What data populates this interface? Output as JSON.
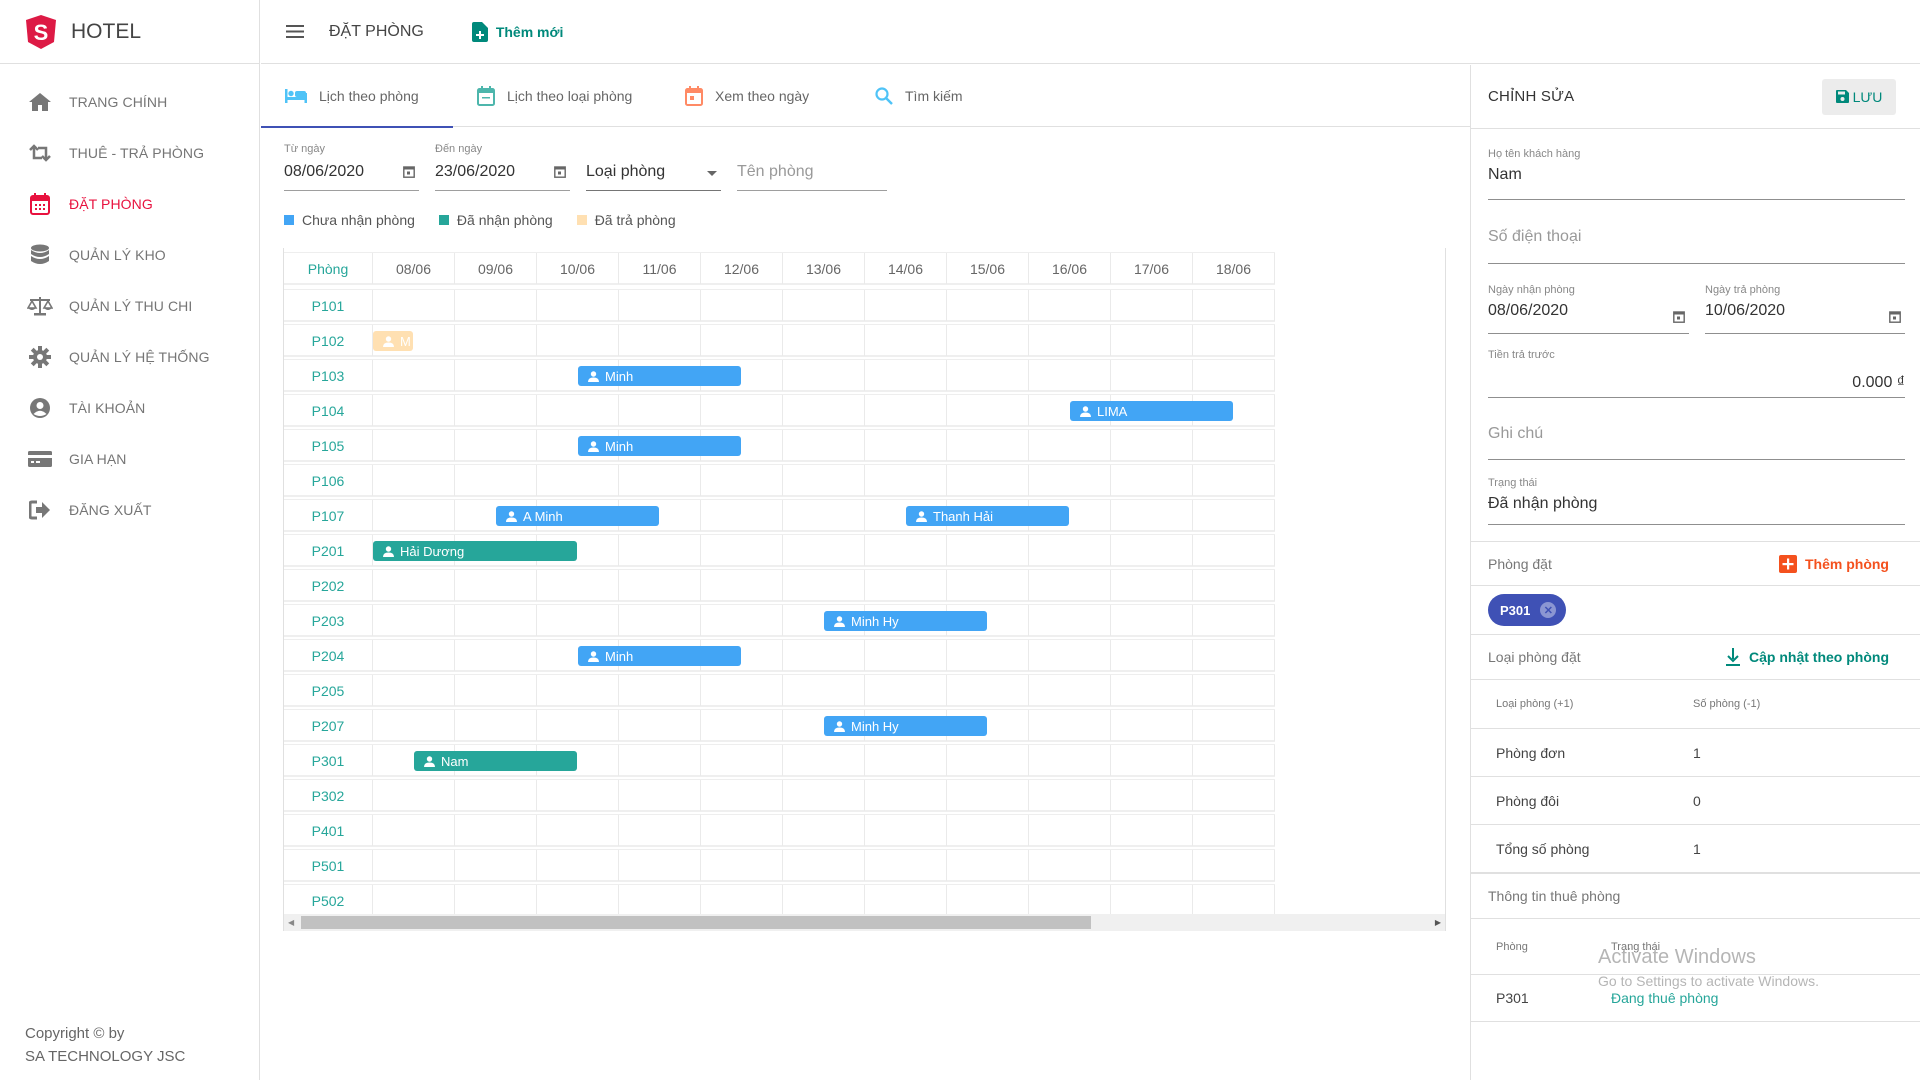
{
  "brand": {
    "name": "HOTEL"
  },
  "sidebar": {
    "items": [
      {
        "label": "TRANG CHÍNH",
        "icon": "home-icon",
        "active": false
      },
      {
        "label": "THUÊ - TRẢ PHÒNG",
        "icon": "swap-icon",
        "active": false
      },
      {
        "label": "ĐẶT PHÒNG",
        "icon": "calendar-icon",
        "active": true
      },
      {
        "label": "QUẢN LÝ KHO",
        "icon": "database-icon",
        "active": false
      },
      {
        "label": "QUẢN LÝ THU CHI",
        "icon": "balance-scale-icon",
        "active": false
      },
      {
        "label": "QUẢN LÝ HỆ THỐNG",
        "icon": "gear-icon",
        "active": false
      },
      {
        "label": "TÀI KHOẢN",
        "icon": "account-circle-icon",
        "active": false
      },
      {
        "label": "GIA HẠN",
        "icon": "credit-card-icon",
        "active": false
      },
      {
        "label": "ĐĂNG XUẤT",
        "icon": "logout-icon",
        "active": false
      }
    ],
    "copyright_line1": "Copyright © by",
    "copyright_line2": "SA TECHNOLOGY JSC"
  },
  "topbar": {
    "title": "ĐẶT PHÒNG",
    "add_new": "Thêm mới"
  },
  "tabs": [
    {
      "label": "Lịch theo phòng",
      "icon": "bed-icon",
      "active": true
    },
    {
      "label": "Lịch theo loại phòng",
      "icon": "calendar-icon",
      "active": false
    },
    {
      "label": "Xem theo ngày",
      "icon": "calendar-day-icon",
      "active": false
    },
    {
      "label": "Tìm kiếm",
      "icon": "search-icon",
      "active": false
    }
  ],
  "filters": {
    "from_label": "Từ ngày",
    "from_value": "08/06/2020",
    "to_label": "Đến ngày",
    "to_value": "23/06/2020",
    "room_type_value": "Loại phòng",
    "room_name_placeholder": "Tên phòng"
  },
  "legend": [
    {
      "label": "Chưa nhận phòng",
      "color": "#42a5f5"
    },
    {
      "label": "Đã nhận phòng",
      "color": "#26a69a"
    },
    {
      "label": "Đã trả phòng",
      "color": "#ffe0b2"
    }
  ],
  "schedule": {
    "room_header": "Phòng",
    "dates": [
      "08/06",
      "09/06",
      "10/06",
      "11/06",
      "12/06",
      "13/06",
      "14/06",
      "15/06",
      "16/06",
      "17/06",
      "18/06"
    ],
    "rooms": [
      "P101",
      "P102",
      "P103",
      "P104",
      "P105",
      "P106",
      "P107",
      "P201",
      "P202",
      "P203",
      "P204",
      "P205",
      "P207",
      "P301",
      "P302",
      "P401",
      "P501",
      "P502"
    ],
    "bookings": [
      {
        "room": "P102",
        "guest": "M",
        "start": 0,
        "end": 0.5,
        "status": "checked_out"
      },
      {
        "room": "P103",
        "guest": "Minh",
        "start": 2.5,
        "end": 4.5,
        "status": "not_checked_in"
      },
      {
        "room": "P104",
        "guest": "LIMA",
        "start": 8.5,
        "end": 10.5,
        "status": "not_checked_in"
      },
      {
        "room": "P105",
        "guest": "Minh",
        "start": 2.5,
        "end": 4.5,
        "status": "not_checked_in"
      },
      {
        "room": "P107",
        "guest": "A Minh",
        "start": 1.5,
        "end": 3.5,
        "status": "not_checked_in"
      },
      {
        "room": "P107",
        "guest": "Thanh Hải",
        "start": 6.5,
        "end": 8.5,
        "status": "not_checked_in"
      },
      {
        "room": "P201",
        "guest": "Hải Dương",
        "start": 0,
        "end": 2.5,
        "status": "checked_in"
      },
      {
        "room": "P203",
        "guest": "Minh Hy",
        "start": 5.5,
        "end": 7.5,
        "status": "not_checked_in"
      },
      {
        "room": "P204",
        "guest": "Minh",
        "start": 2.5,
        "end": 4.5,
        "status": "not_checked_in"
      },
      {
        "room": "P207",
        "guest": "Minh Hy",
        "start": 5.5,
        "end": 7.5,
        "status": "not_checked_in"
      },
      {
        "room": "P301",
        "guest": "Nam",
        "start": 0.5,
        "end": 2.5,
        "status": "checked_in"
      }
    ],
    "status_colors": {
      "not_checked_in": "#42a5f5",
      "checked_in": "#26a69a",
      "checked_out": "#ffe0b2"
    },
    "scroll_fraction": 0.7
  },
  "panel": {
    "title": "CHỈNH SỬA",
    "save": "LƯU",
    "name_label": "Họ tên khách hàng",
    "name_value": "Nam",
    "phone_placeholder": "Số điện thoại",
    "checkin_label": "Ngày nhận phòng",
    "checkin_value": "08/06/2020",
    "checkout_label": "Ngày trả phòng",
    "checkout_value": "10/06/2020",
    "deposit_label": "Tiền trả trước",
    "deposit_value": "0.000 ₫",
    "note_placeholder": "Ghi chú",
    "status_label": "Trạng thái",
    "status_value": "Đã nhận phòng",
    "booked_rooms_label": "Phòng đặt",
    "add_room": "Thêm phòng",
    "chips": [
      "P301"
    ],
    "room_types_label": "Loại phòng đặt",
    "update_by_room": "Cập nhật theo phòng",
    "type_table": {
      "headers": [
        "Loại phòng (+1)",
        "Số phòng (-1)"
      ],
      "rows": [
        [
          "Phòng đơn",
          "1"
        ],
        [
          "Phòng đôi",
          "0"
        ],
        [
          "Tổng số phòng",
          "1"
        ]
      ]
    },
    "rental_info_label": "Thông tin thuê phòng",
    "rental_table": {
      "headers": [
        "Phòng",
        "Trạng thái"
      ],
      "rows": [
        [
          "P301",
          "Đang thuê phòng"
        ]
      ]
    }
  },
  "watermark": {
    "line1": "Activate Windows",
    "line2": "Go to Settings to activate Windows."
  }
}
